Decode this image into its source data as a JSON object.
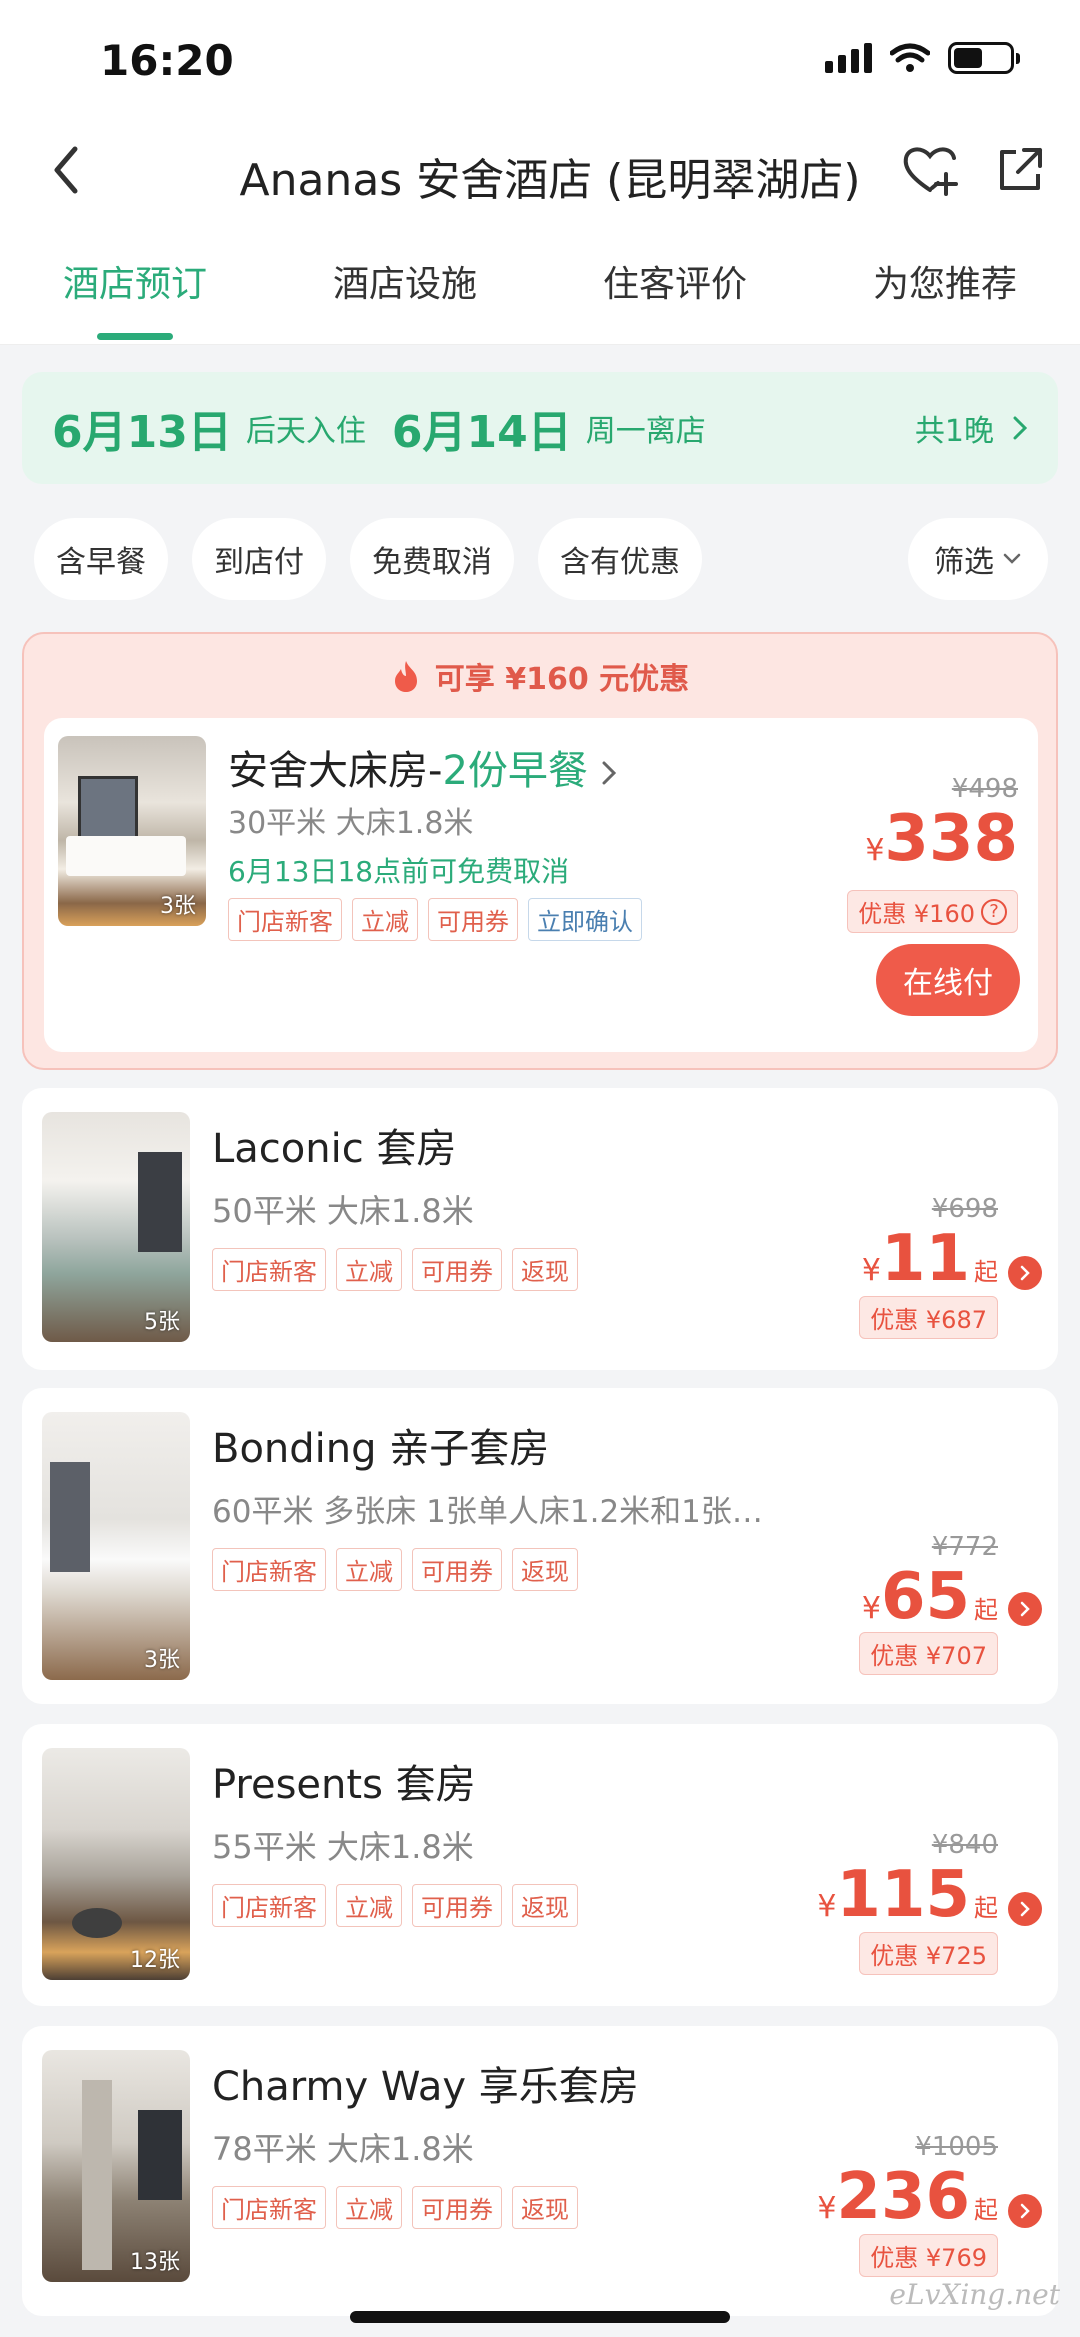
{
  "status": {
    "time": "16:20"
  },
  "header": {
    "title": "Ananas 安舍酒店 (昆明翠湖店)"
  },
  "tabs": [
    "酒店预订",
    "酒店设施",
    "住客评价",
    "为您推荐"
  ],
  "dates": {
    "checkin": "6月13日",
    "checkin_note": "后天入住",
    "checkout": "6月14日",
    "checkout_note": "周一离店",
    "nights": "共1晚"
  },
  "filters": [
    "含早餐",
    "到店付",
    "免费取消",
    "含有优惠",
    "筛选"
  ],
  "promo": {
    "banner": "可享 ¥160 元优惠",
    "room": {
      "name": "安舍大床房-",
      "name_green": "2份早餐",
      "sub": "30平米  大床1.8米",
      "cancel": "6月13日18点前可免费取消",
      "tags": [
        "门店新客",
        "立减",
        "可用券",
        "立即确认"
      ],
      "photos": "3张",
      "orig_price": "¥498",
      "yen": "¥",
      "price": "338",
      "discount": "优惠 ¥160",
      "pay": "在线付"
    }
  },
  "rooms": [
    {
      "name": "Laconic 套房",
      "sub": "50平米  大床1.8米",
      "tags": [
        "门店新客",
        "立减",
        "可用券",
        "返现"
      ],
      "photos": "5张",
      "orig_price": "¥698",
      "yen": "¥",
      "price": "11",
      "qi": "起",
      "discount": "优惠 ¥687"
    },
    {
      "name": "Bonding 亲子套房",
      "sub": "60平米  多张床 1张单人床1.2米和1张…",
      "tags": [
        "门店新客",
        "立减",
        "可用券",
        "返现"
      ],
      "photos": "3张",
      "orig_price": "¥772",
      "yen": "¥",
      "price": "65",
      "qi": "起",
      "discount": "优惠 ¥707"
    },
    {
      "name": "Presents 套房",
      "sub": "55平米  大床1.8米",
      "tags": [
        "门店新客",
        "立减",
        "可用券",
        "返现"
      ],
      "photos": "12张",
      "orig_price": "¥840",
      "yen": "¥",
      "price": "115",
      "qi": "起",
      "discount": "优惠 ¥725"
    },
    {
      "name": "Charmy Way 享乐套房",
      "sub": "78平米  大床1.8米",
      "tags": [
        "门店新客",
        "立减",
        "可用券",
        "返现"
      ],
      "photos": "13张",
      "orig_price": "¥1005",
      "yen": "¥",
      "price": "236",
      "qi": "起",
      "discount": "优惠 ¥769"
    }
  ],
  "watermark": "eLvXing.net",
  "colors": {
    "accent_green": "#2bab7a",
    "price_red": "#e8523f"
  }
}
